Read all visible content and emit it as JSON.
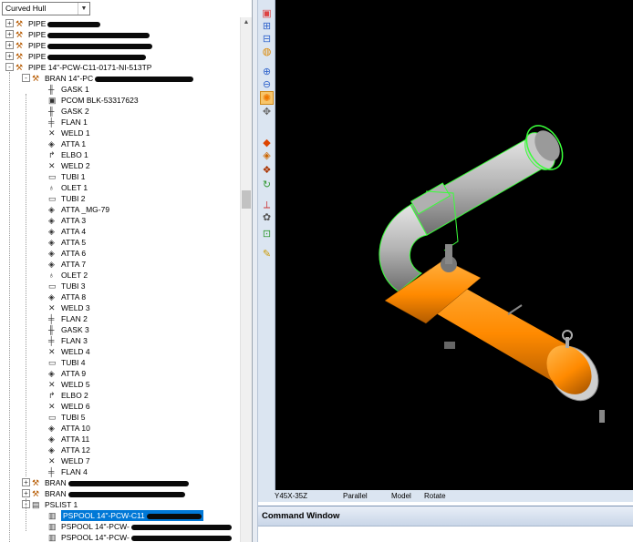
{
  "dropdown": {
    "value": "Curved Hull"
  },
  "tree": [
    {
      "depth": 0,
      "exp": "+",
      "icon": "pipe-icon",
      "label": "PIPE",
      "redacted": true,
      "rw": 58
    },
    {
      "depth": 0,
      "exp": "+",
      "icon": "pipe-icon",
      "label": "PIPE",
      "redacted": true,
      "rw": 112
    },
    {
      "depth": 0,
      "exp": "+",
      "icon": "pipe-icon",
      "label": "PIPE",
      "redacted": true,
      "rw": 115
    },
    {
      "depth": 0,
      "exp": "+",
      "icon": "pipe-icon",
      "label": "PIPE",
      "redacted": true,
      "rw": 108
    },
    {
      "depth": 0,
      "exp": "-",
      "icon": "pipe-icon",
      "label": "PIPE 14\"-PCW-C11-0171-NI-513TP",
      "redacted": false
    },
    {
      "depth": 1,
      "exp": "-",
      "icon": "branch-icon",
      "label": "BRAN 14\"-PC",
      "redacted": true,
      "rw": 108
    },
    {
      "depth": 2,
      "icon": "gasket-icon",
      "label": "GASK 1"
    },
    {
      "depth": 2,
      "icon": "pcom-icon",
      "label": "PCOM BLK-53317623"
    },
    {
      "depth": 2,
      "icon": "gasket-icon",
      "label": "GASK 2"
    },
    {
      "depth": 2,
      "icon": "flange-icon",
      "label": "FLAN 1"
    },
    {
      "depth": 2,
      "icon": "weld-icon",
      "label": "WELD 1"
    },
    {
      "depth": 2,
      "icon": "attachment-icon",
      "label": "ATTA 1"
    },
    {
      "depth": 2,
      "icon": "elbow-icon",
      "label": "ELBO 1"
    },
    {
      "depth": 2,
      "icon": "weld-icon",
      "label": "WELD 2"
    },
    {
      "depth": 2,
      "icon": "tube-icon",
      "label": "TUBI 1"
    },
    {
      "depth": 2,
      "icon": "olet-icon",
      "label": "OLET 1"
    },
    {
      "depth": 2,
      "icon": "tube-icon",
      "label": "TUBI 2"
    },
    {
      "depth": 2,
      "icon": "attachment-icon",
      "label": "ATTA _MG-79"
    },
    {
      "depth": 2,
      "icon": "attachment-icon",
      "label": "ATTA 3"
    },
    {
      "depth": 2,
      "icon": "attachment-icon",
      "label": "ATTA 4"
    },
    {
      "depth": 2,
      "icon": "attachment-icon",
      "label": "ATTA 5"
    },
    {
      "depth": 2,
      "icon": "attachment-icon",
      "label": "ATTA 6"
    },
    {
      "depth": 2,
      "icon": "attachment-icon",
      "label": "ATTA 7"
    },
    {
      "depth": 2,
      "icon": "olet-icon",
      "label": "OLET 2"
    },
    {
      "depth": 2,
      "icon": "tube-icon",
      "label": "TUBI 3"
    },
    {
      "depth": 2,
      "icon": "attachment-icon",
      "label": "ATTA 8"
    },
    {
      "depth": 2,
      "icon": "weld-icon",
      "label": "WELD 3"
    },
    {
      "depth": 2,
      "icon": "flange-icon",
      "label": "FLAN 2"
    },
    {
      "depth": 2,
      "icon": "gasket-icon",
      "label": "GASK 3"
    },
    {
      "depth": 2,
      "icon": "flange-icon",
      "label": "FLAN 3"
    },
    {
      "depth": 2,
      "icon": "weld-icon",
      "label": "WELD 4"
    },
    {
      "depth": 2,
      "icon": "tube-icon",
      "label": "TUBI 4"
    },
    {
      "depth": 2,
      "icon": "attachment-icon",
      "label": "ATTA 9"
    },
    {
      "depth": 2,
      "icon": "weld-icon",
      "label": "WELD 5"
    },
    {
      "depth": 2,
      "icon": "elbow-icon",
      "label": "ELBO 2"
    },
    {
      "depth": 2,
      "icon": "weld-icon",
      "label": "WELD 6"
    },
    {
      "depth": 2,
      "icon": "tube-icon",
      "label": "TUBI 5"
    },
    {
      "depth": 2,
      "icon": "attachment-icon",
      "label": "ATTA 10"
    },
    {
      "depth": 2,
      "icon": "attachment-icon",
      "label": "ATTA 11"
    },
    {
      "depth": 2,
      "icon": "attachment-icon",
      "label": "ATTA 12"
    },
    {
      "depth": 2,
      "icon": "weld-icon",
      "label": "WELD 7"
    },
    {
      "depth": 2,
      "icon": "flange-icon",
      "label": "FLAN 4"
    },
    {
      "depth": 1,
      "exp": "+",
      "icon": "branch-icon",
      "label": "BRAN",
      "redacted": true,
      "rw": 132
    },
    {
      "depth": 1,
      "exp": "+",
      "icon": "branch-icon",
      "label": "BRAN",
      "redacted": true,
      "rw": 128
    },
    {
      "depth": 1,
      "exp": "-",
      "icon": "pslist-icon",
      "label": "PSLIST 1"
    },
    {
      "depth": 2,
      "icon": "pspool-icon",
      "label": "PSPOOL 14\"-PCW-C11",
      "redacted": true,
      "rw": 60,
      "selected": true
    },
    {
      "depth": 2,
      "icon": "pspool-icon",
      "label": "PSPOOL 14\"-PCW-",
      "redacted": true,
      "rw": 110
    },
    {
      "depth": 2,
      "icon": "pspool-icon",
      "label": "PSPOOL 14\"-PCW-",
      "redacted": true,
      "rw": 110
    }
  ],
  "toolbar": [
    "view-icon",
    "zoom-window-icon",
    "zoom-extents-icon",
    "walk-icon",
    "zoom-in-icon",
    "zoom-out-icon",
    "rotate-icon",
    "pan-icon",
    "shaded-icon",
    "layers-icon",
    "explode-icon",
    "refresh-icon",
    "axis-icon",
    "settings-icon",
    "clip-icon",
    "measure-icon"
  ],
  "status": {
    "direction": "Y45X-35Z",
    "projection": "Parallel",
    "mode": "Model",
    "action": "Rotate"
  },
  "command_window": {
    "title": "Command Window"
  },
  "colors": {
    "highlight": "#0078d7",
    "pipe_gray": "#b4b4b4",
    "pipe_orange": "#ff8a00",
    "select_green": "#3aff3a",
    "viewport": "#000000"
  }
}
